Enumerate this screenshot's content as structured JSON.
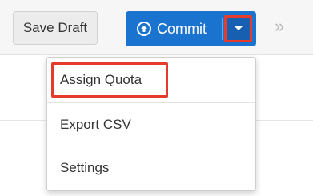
{
  "toolbar": {
    "save_draft_label": "Save Draft",
    "commit_label": "Commit",
    "more_icon_glyph": "»"
  },
  "menu": {
    "items": [
      {
        "label": "Assign Quota"
      },
      {
        "label": "Export CSV"
      },
      {
        "label": "Settings"
      }
    ]
  },
  "colors": {
    "primary": "#1b73d0",
    "highlight": "#e53b2c"
  }
}
